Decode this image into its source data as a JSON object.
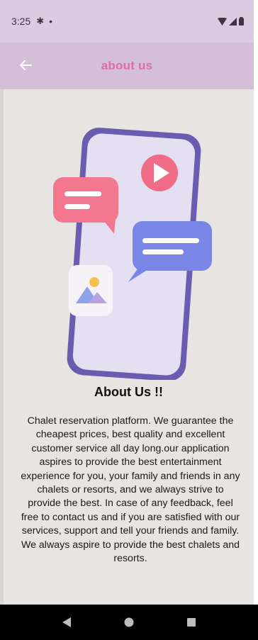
{
  "status_bar": {
    "time": "3:25",
    "icons": [
      "gear-icon",
      "dot-icon",
      "wifi-icon",
      "signal-icon",
      "battery-icon"
    ]
  },
  "app_bar": {
    "title": "about us",
    "back_icon": "arrow-left-icon",
    "title_color": "#e26aa8",
    "background": "#d5bfd8"
  },
  "about": {
    "heading": "About Us !!",
    "text": "Chalet reservation platform. We guarantee the cheapest prices, best quality and excellent customer service all day long.our application aspires to provide the best entertainment experience for you, your family and friends in any chalets or resorts, and we always strive to provide the best. In case of any feedback, feel free to contact us and if you are satisfied with our services, support and tell your friends and family. We always aspire to provide the best chalets and resorts."
  },
  "nav_bar": {
    "buttons": [
      "back-triangle-icon",
      "home-circle-icon",
      "recents-square-icon"
    ]
  }
}
